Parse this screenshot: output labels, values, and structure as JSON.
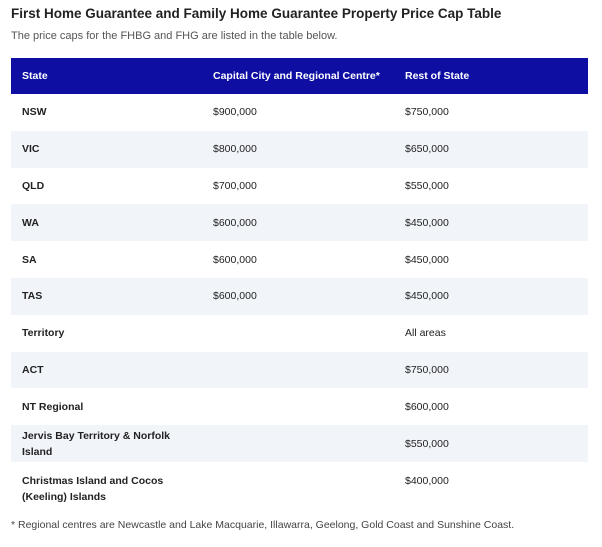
{
  "title": "First Home Guarantee and Family Home Guarantee Property Price Cap Table",
  "subtitle": "The price caps for the FHBG and FHG are listed in the table below.",
  "table": {
    "headers": [
      "State",
      "Capital City and Regional Centre*",
      "Rest of State"
    ],
    "rows": [
      [
        "NSW",
        "$900,000",
        "$750,000"
      ],
      [
        "VIC",
        "$800,000",
        "$650,000"
      ],
      [
        "QLD",
        "$700,000",
        "$550,000"
      ],
      [
        "WA",
        "$600,000",
        "$450,000"
      ],
      [
        "SA",
        "$600,000",
        "$450,000"
      ],
      [
        "TAS",
        "$600,000",
        "$450,000"
      ],
      [
        "Territory",
        "",
        "All areas"
      ],
      [
        "ACT",
        "",
        "$750,000"
      ],
      [
        "NT Regional",
        "",
        "$600,000"
      ],
      [
        "Jervis Bay Territory & Norfolk Island",
        "",
        "$550,000"
      ],
      [
        "Christmas Island and Cocos (Keeling) Islands",
        "",
        "$400,000"
      ]
    ]
  },
  "footnote": "* Regional centres are Newcastle and Lake Macquarie, Illawarra, Geelong, Gold Coast and Sunshine Coast.",
  "colors": {
    "header_bg": "#0e0ea3",
    "header_text": "#ffffff",
    "alt_row_bg": "#f1f5fa"
  }
}
